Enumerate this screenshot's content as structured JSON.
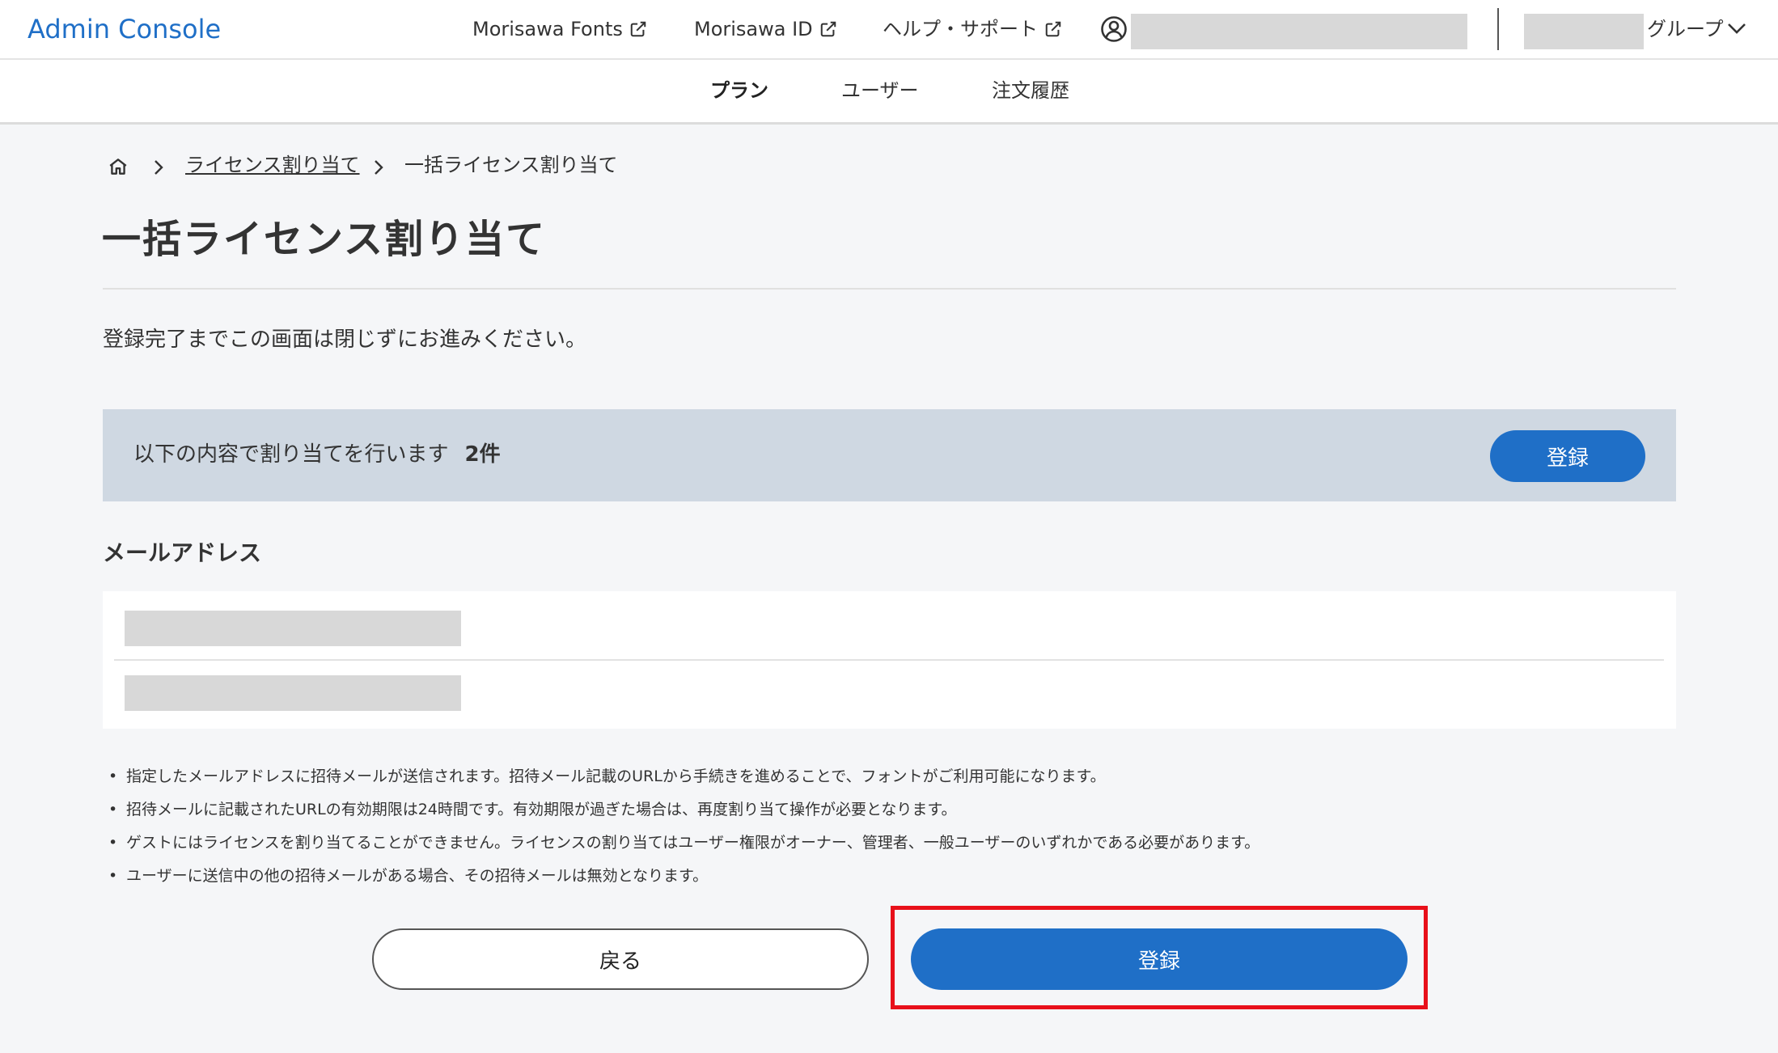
{
  "header": {
    "brand": "Admin Console",
    "links": [
      {
        "label": "Morisawa Fonts"
      },
      {
        "label": "Morisawa ID"
      },
      {
        "label": "ヘルプ・サポート"
      }
    ],
    "group_label": "グループ"
  },
  "nav": {
    "tabs": [
      {
        "label": "プラン",
        "active": true
      },
      {
        "label": "ユーザー",
        "active": false
      },
      {
        "label": "注文履歴",
        "active": false
      }
    ]
  },
  "breadcrumb": {
    "link": "ライセンス割り当て",
    "current": "一括ライセンス割り当て"
  },
  "page": {
    "title": "一括ライセンス割り当て",
    "notice": "登録完了までこの画面は閉じずにお進みください。"
  },
  "summary": {
    "text": "以下の内容で割り当てを行います",
    "count": "2件",
    "register_label": "登録"
  },
  "emails": {
    "section_label": "メールアドレス"
  },
  "notes": [
    "指定したメールアドレスに招待メールが送信されます。招待メール記載のURLから手続きを進めることで、フォントがご利用可能になります。",
    "招待メールに記載されたURLの有効期限は24時間です。有効期限が過ぎた場合は、再度割り当て操作が必要となります。",
    "ゲストにはライセンスを割り当てることができません。ライセンスの割り当てはユーザー権限がオーナー、管理者、一般ユーザーのいずれかである必要があります。",
    "ユーザーに送信中の他の招待メールがある場合、その招待メールは無効となります。"
  ],
  "actions": {
    "back_label": "戻る",
    "register_label": "登録"
  },
  "colors": {
    "accent": "#1f6fc7",
    "summary_bg": "#cfd8e2",
    "highlight": "#e8101a",
    "page_bg": "#f5f6f8"
  }
}
